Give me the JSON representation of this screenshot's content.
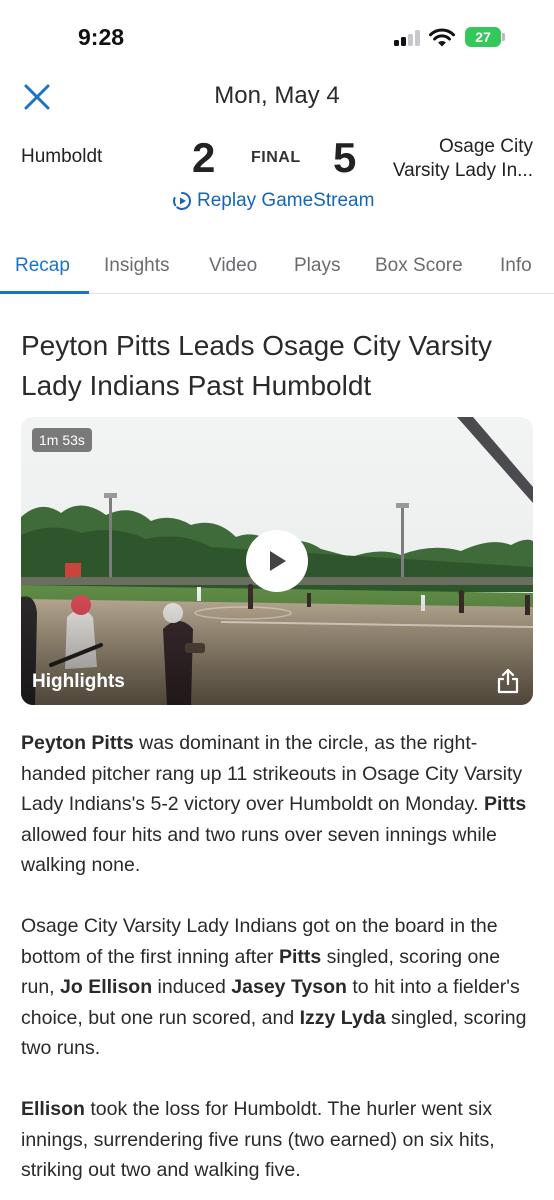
{
  "status": {
    "time": "9:28",
    "battery": "27"
  },
  "header": {
    "date": "Mon, May 4"
  },
  "game": {
    "home_team": "Humboldt",
    "home_score": "2",
    "status": "FINAL",
    "away_score": "5",
    "away_team_line1": "Osage City",
    "away_team_line2": "Varsity Lady In...",
    "replay_label": "Replay GameStream"
  },
  "tabs": [
    {
      "label": "Recap",
      "active": true
    },
    {
      "label": "Insights"
    },
    {
      "label": "Video"
    },
    {
      "label": "Plays"
    },
    {
      "label": "Box Score"
    },
    {
      "label": "Info"
    }
  ],
  "article": {
    "headline": "Peyton Pitts Leads Osage City Varsity Lady Indians Past Humboldt",
    "video": {
      "duration": "1m 53s",
      "label": "Highlights"
    },
    "paragraphs": [
      [
        {
          "b": true,
          "t": "Peyton Pitts"
        },
        {
          "t": " was dominant in the circle, as the right-handed pitcher rang up 11 strikeouts in Osage City Varsity Lady Indians's 5-2 victory over Humboldt on Monday. "
        },
        {
          "b": true,
          "t": "Pitts"
        },
        {
          "t": " allowed four hits and two runs over seven innings while walking none."
        }
      ],
      [
        {
          "t": "Osage City Varsity Lady Indians got on the board in the bottom of the first inning after "
        },
        {
          "b": true,
          "t": "Pitts"
        },
        {
          "t": " singled, scoring one run, "
        },
        {
          "b": true,
          "t": "Jo Ellison"
        },
        {
          "t": " induced "
        },
        {
          "b": true,
          "t": "Jasey Tyson"
        },
        {
          "t": " to hit into a fielder's choice, but one run scored, and "
        },
        {
          "b": true,
          "t": "Izzy Lyda"
        },
        {
          "t": " singled, scoring two runs."
        }
      ],
      [
        {
          "b": true,
          "t": "Ellison"
        },
        {
          "t": " took the loss for Humboldt. The hurler went six innings, surrendering five runs (two earned) on six hits, striking out two and walking five."
        }
      ]
    ]
  },
  "colors": {
    "accent": "#1a73c7",
    "battery": "#34c759"
  }
}
